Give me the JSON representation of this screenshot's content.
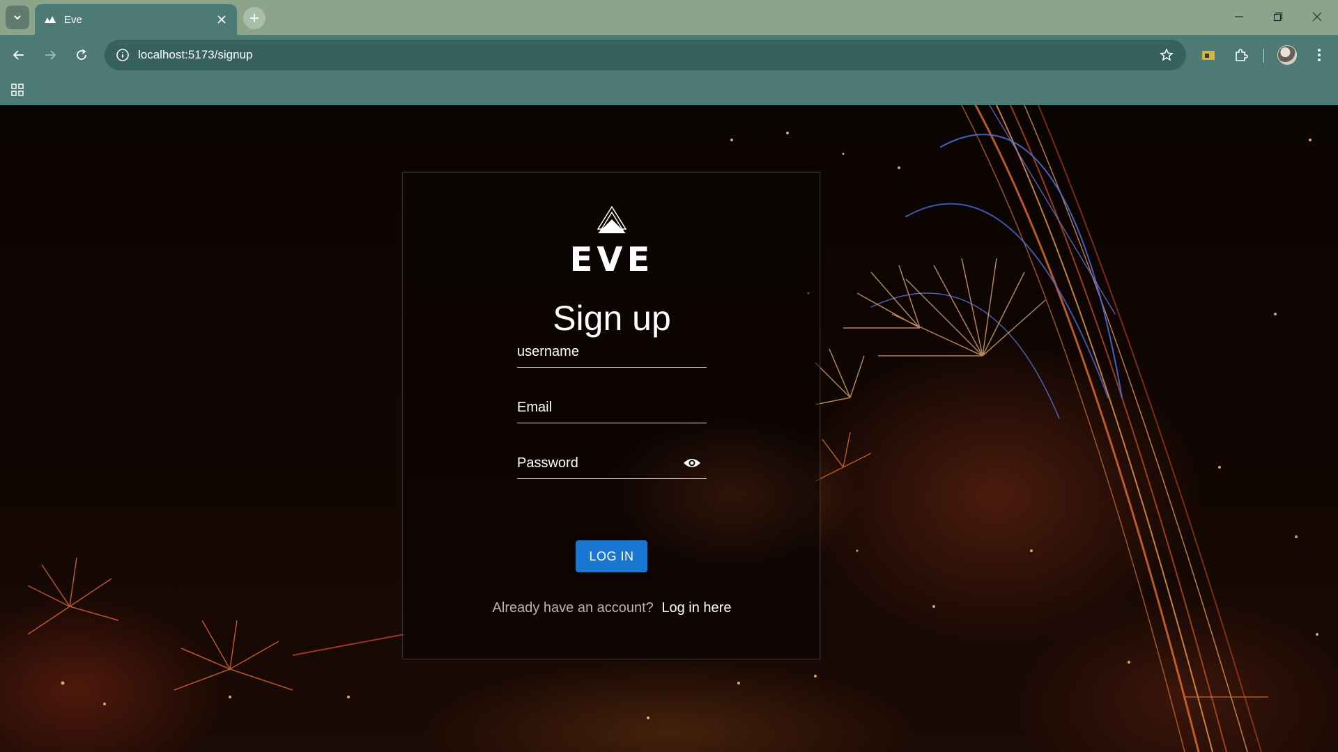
{
  "browser": {
    "tab_title": "Eve",
    "url": "localhost:5173/signup"
  },
  "icons": {
    "tab_search": "chevron-down-icon",
    "favicon": "eve-favicon-icon",
    "tab_close": "close-icon",
    "new_tab": "plus-icon",
    "minimize": "minimize-icon",
    "restore": "restore-icon",
    "close_window": "close-icon",
    "back": "arrow-left-icon",
    "forward": "arrow-right-icon",
    "reload": "reload-icon",
    "site_info": "info-icon",
    "bookmark": "star-icon",
    "extension_1": "folder-extension-icon",
    "extensions": "puzzle-icon",
    "profile": "avatar",
    "menu": "kebab-icon",
    "apps": "apps-grid-icon",
    "password_toggle": "eye-icon"
  },
  "colors": {
    "tabstrip": "#8ba48a",
    "toolbar": "#4d7a74",
    "button": "#1976d2"
  },
  "card": {
    "logo_text": "EVE",
    "heading": "Sign up",
    "fields": {
      "username_label": "username",
      "email_label": "Email",
      "password_label": "Password"
    },
    "submit_label": "LOG IN",
    "footer_question": "Already have an account?",
    "footer_link": "Log in here"
  }
}
